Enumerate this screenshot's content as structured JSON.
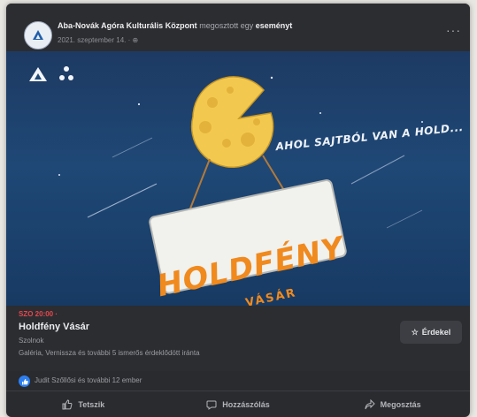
{
  "post": {
    "author": "Aba-Novák Agóra Kulturális Központ",
    "verb": "megosztott egy",
    "object": "eseményt",
    "date": "2021. szeptember 14. ·",
    "more": "···"
  },
  "cover": {
    "slogan": "AHOL SAJTBÓL VAN A HOLD...",
    "sign_title": "HOLDFÉNY",
    "sign_subtitle": "VÁSÁR"
  },
  "event": {
    "date": "SZO 20:00 ·",
    "name": "Holdfény Vásár",
    "host": "Szolnok",
    "location": "Galéria, Vernissza és további 5 ismerős érdeklődött iránta",
    "interested_label": "Érdekel",
    "interested_icon": "star-icon"
  },
  "reactions": {
    "text": "Judit Szőllősi és további 12 ember"
  },
  "actions": [
    {
      "label": "Tetszik",
      "icon": "thumbs-up-icon"
    },
    {
      "label": "Hozzászólás",
      "icon": "comment-icon"
    },
    {
      "label": "Megosztás",
      "icon": "share-icon"
    }
  ],
  "colors": {
    "card_bg": "#2a2b2f",
    "event_date_red": "#e5484d",
    "like_blue": "#2d7ff0",
    "sign_orange": "#f08a1e",
    "cover_blue": "#1f4876"
  }
}
